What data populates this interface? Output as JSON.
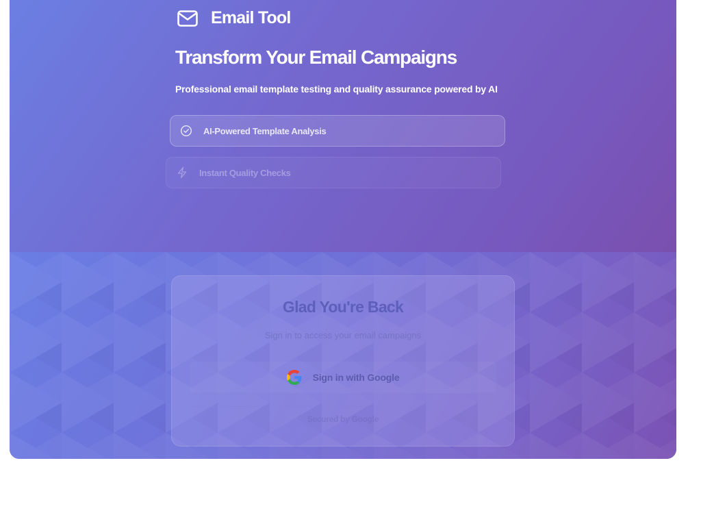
{
  "colors": {
    "hero_gradient_start": "#6b7fe2",
    "hero_gradient_end": "#7a4fae",
    "card_title": "#5d5fba",
    "google_blue": "#4285F4",
    "google_red": "#EA4335",
    "google_yellow": "#FBBC05",
    "google_green": "#34A853"
  },
  "brand": {
    "icon": "mail-icon",
    "name": "Email Tool"
  },
  "hero": {
    "title": "Transform Your Email Campaigns",
    "subtitle": "Professional email template testing and quality assurance powered by AI",
    "features": [
      {
        "icon": "check-circle-icon",
        "label": "AI-Powered Template Analysis"
      },
      {
        "icon": "lightning-icon",
        "label": "Instant Quality Checks"
      }
    ]
  },
  "login": {
    "title": "Glad You're Back",
    "subtitle": "Sign in to access your email campaigns",
    "google_button": {
      "icon": "google-logo-icon",
      "label": "Sign in with Google"
    },
    "secured_text": "Secured by Google"
  }
}
